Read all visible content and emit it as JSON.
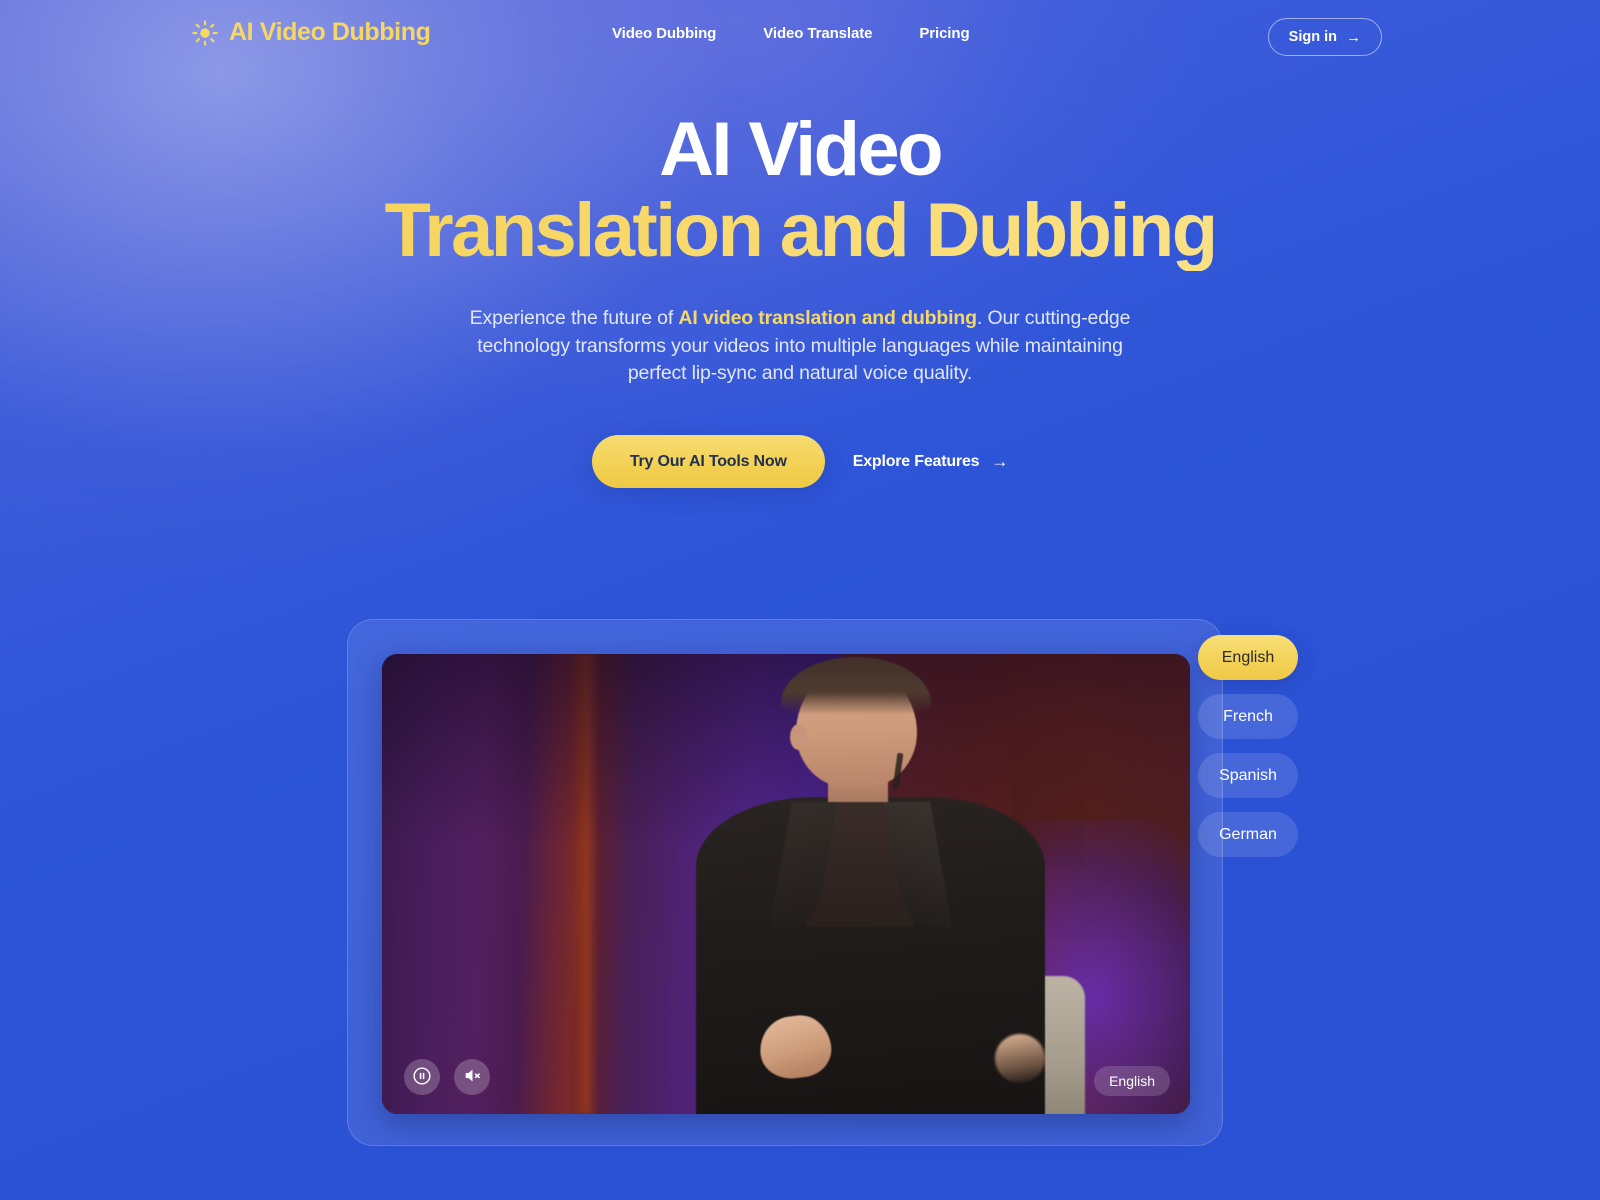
{
  "brand": {
    "name": "AI Video Dubbing",
    "icon": "sun-icon",
    "color": "#F6D765"
  },
  "nav": {
    "links": [
      {
        "label": "Video Dubbing"
      },
      {
        "label": "Video Translate"
      },
      {
        "label": "Pricing"
      }
    ],
    "signin": {
      "label": "Sign in",
      "arrow": "→"
    }
  },
  "hero": {
    "title_line1": "AI Video",
    "title_line2": "Translation and Dubbing",
    "subtitle_before": "Experience the future of ",
    "subtitle_highlight": "AI video translation and dubbing",
    "subtitle_after": ". Our cutting-edge technology transforms your videos into multiple languages while maintaining perfect lip-sync and natural voice quality.",
    "cta_primary": "Try Our AI Tools Now",
    "cta_secondary": "Explore Features",
    "cta_secondary_arrow": "→"
  },
  "player": {
    "controls": {
      "pause_label": "pause",
      "mute_label": "unmute"
    },
    "current_language_badge": "English"
  },
  "languages": [
    {
      "label": "English",
      "active": true
    },
    {
      "label": "French",
      "active": false
    },
    {
      "label": "Spanish",
      "active": false
    },
    {
      "label": "German",
      "active": false
    }
  ],
  "colors": {
    "background_blue": "#2B51D4",
    "accent_yellow": "#F3D257",
    "text_white": "#FFFFFF",
    "subtitle": "#E2E6FA"
  }
}
